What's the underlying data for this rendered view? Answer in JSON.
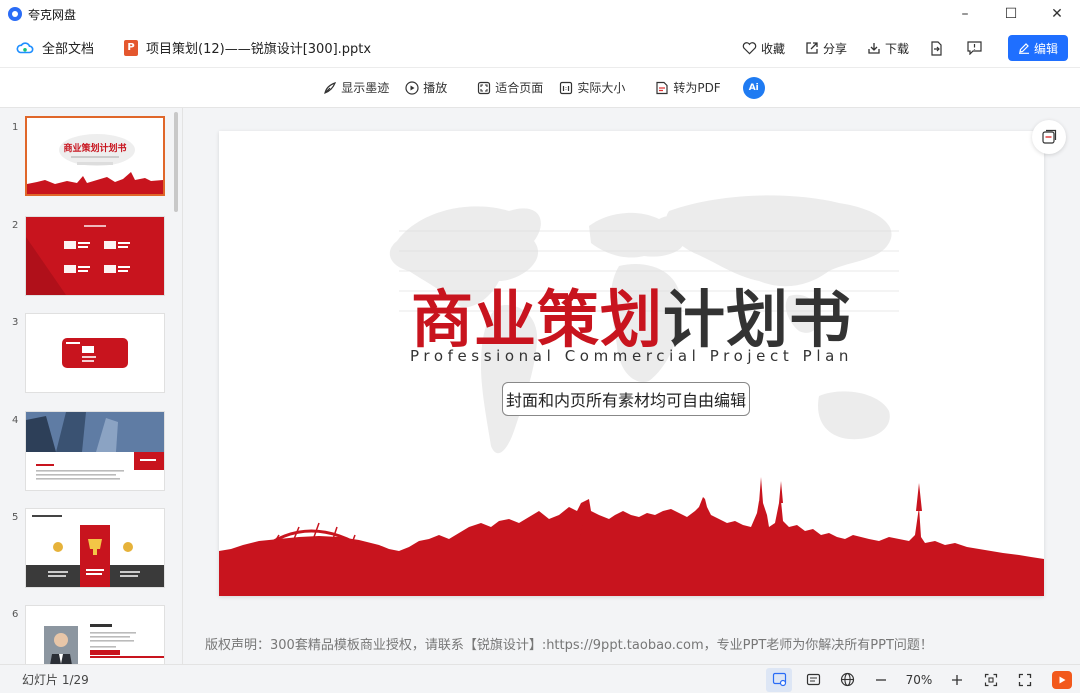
{
  "app": {
    "title": "夸克网盘"
  },
  "window": {
    "minimize": "–",
    "maximize": "☐",
    "close": "✕"
  },
  "filebar": {
    "all_docs": "全部文档",
    "file_badge": "P",
    "file_name": "项目策划(12)——锐旗设计[300].pptx",
    "favorite": "收藏",
    "share": "分享",
    "download": "下载",
    "edit": "编辑"
  },
  "toolbar": {
    "show_ink": "显示墨迹",
    "play": "播放",
    "fit_page": "适合页面",
    "actual_size": "实际大小",
    "to_pdf": "转为PDF",
    "ai_label": "Ai"
  },
  "thumbnails": [
    {
      "num": "1",
      "title": "商业策划计划书"
    },
    {
      "num": "2"
    },
    {
      "num": "3"
    },
    {
      "num": "4"
    },
    {
      "num": "5"
    },
    {
      "num": "6"
    }
  ],
  "slide": {
    "title_red": "商业策划",
    "title_dark": "计划书",
    "subtitle": "Professional Commercial Project Plan",
    "box_text": "封面和内页所有素材均可自由编辑"
  },
  "copyright": "版权声明：300套精品模板商业授权，请联系【锐旗设计】:https://9ppt.taobao.com，专业PPT老师为你解决所有PPT问题！",
  "status": {
    "slide_count": "幻灯片 1/29",
    "zoom": "70%"
  },
  "colors": {
    "accent": "#1f6fff",
    "brand_red": "#c8141e"
  }
}
